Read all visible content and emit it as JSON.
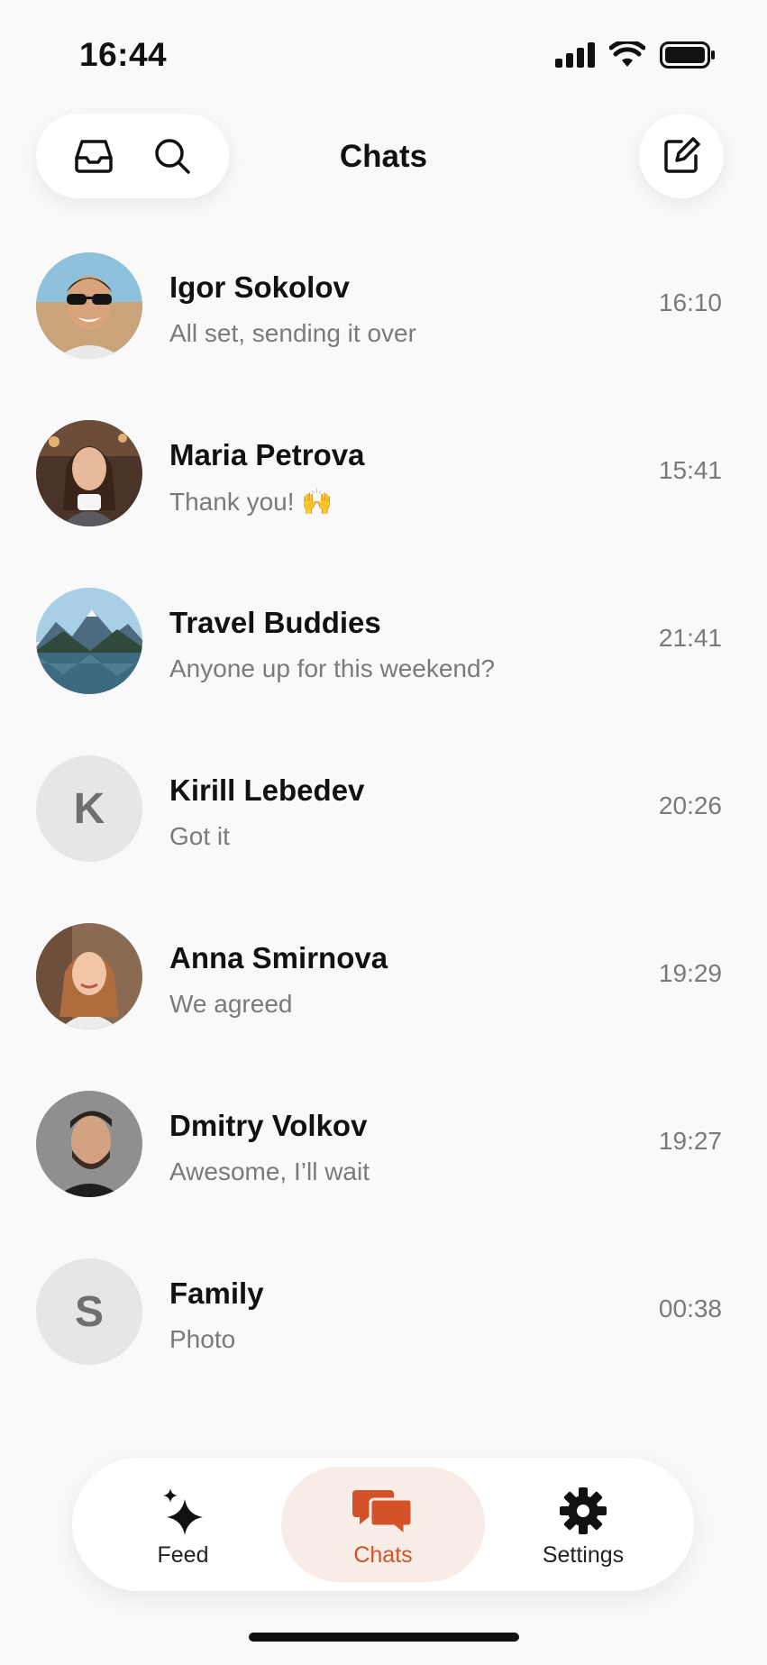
{
  "status_bar": {
    "time": "16:44"
  },
  "header": {
    "title": "Chats"
  },
  "chats": [
    {
      "name": "Igor Sokolov",
      "preview": "All set, sending it over",
      "time": "16:10"
    },
    {
      "name": "Maria Petrova",
      "preview": "Thank you! 🙌",
      "time": "15:41"
    },
    {
      "name": "Travel Buddies",
      "preview": "Anyone up for this weekend?",
      "time": "21:41"
    },
    {
      "name": "Kirill Lebedev",
      "preview": "Got it",
      "time": "20:26",
      "initial": "K"
    },
    {
      "name": "Anna Smirnova",
      "preview": "We agreed",
      "time": "19:29"
    },
    {
      "name": "Dmitry Volkov",
      "preview": "Awesome, I’ll wait",
      "time": "19:27"
    },
    {
      "name": "Family",
      "preview": "Photo",
      "time": "00:38",
      "initial": "S"
    }
  ],
  "nav": {
    "feed_label": "Feed",
    "chats_label": "Chats",
    "settings_label": "Settings",
    "active": "Chats"
  },
  "colors": {
    "accent": "#d4522a",
    "accent_bg": "#f8ece6",
    "background": "#f9f9f9",
    "secondary_text": "#7a7a7a"
  },
  "icons": {
    "inbox": "inbox-icon",
    "search": "search-icon",
    "compose": "compose-icon",
    "feed": "sparkles-icon",
    "chats": "chat-bubbles-icon",
    "settings": "gear-icon"
  }
}
